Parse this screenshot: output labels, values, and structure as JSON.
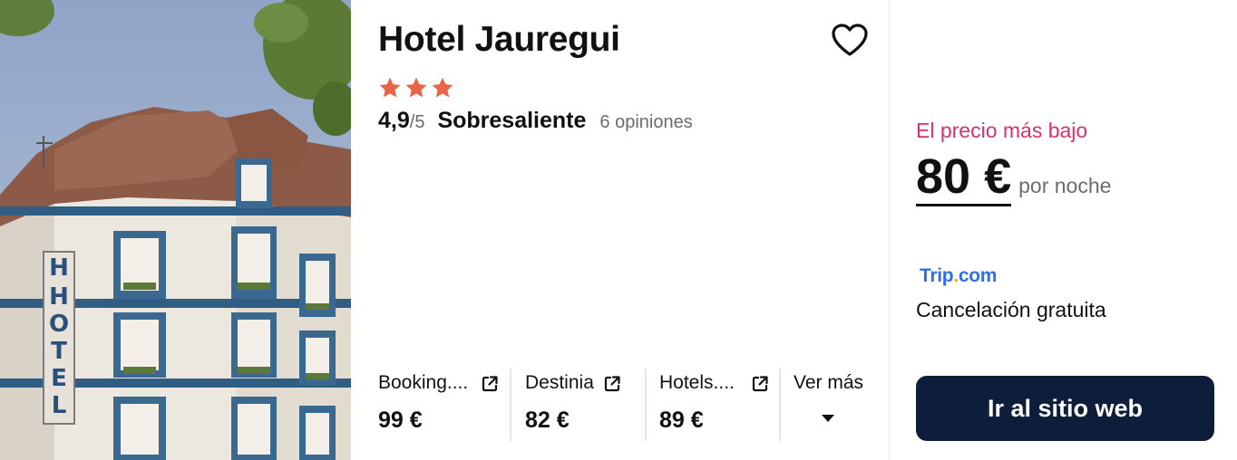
{
  "hotel": {
    "name": "Hotel Jauregui",
    "image_alt": "Hotel Jauregui",
    "stars": 3,
    "star_color": "#e8654a",
    "rating": {
      "score": "4,9",
      "max": "/5",
      "label": "Sobresaliente",
      "reviews": "6 opiniones"
    },
    "favorite_icon": "heart-outline-icon"
  },
  "offers": [
    {
      "provider": "Booking....",
      "price": "99 €",
      "icon": "external-link-icon"
    },
    {
      "provider": "Destinia",
      "price": "82 €",
      "icon": "external-link-icon"
    },
    {
      "provider": "Hotels....",
      "price": "89 €",
      "icon": "external-link-icon"
    }
  ],
  "more": {
    "label": "Ver más",
    "icon": "caret-down-icon"
  },
  "best_deal": {
    "label": "El precio más bajo",
    "price": "80 €",
    "per_night": "por noche",
    "provider_name": "Trip",
    "provider_dot": ".",
    "provider_suffix": "com",
    "cancellation": "Cancelación gratuita",
    "cta_label": "Ir al sitio web"
  },
  "colors": {
    "accent_pink": "#d6336c",
    "cta_bg": "#0e1d3a",
    "trip_blue": "#2e6fe6",
    "trip_dot": "#f4b400"
  }
}
